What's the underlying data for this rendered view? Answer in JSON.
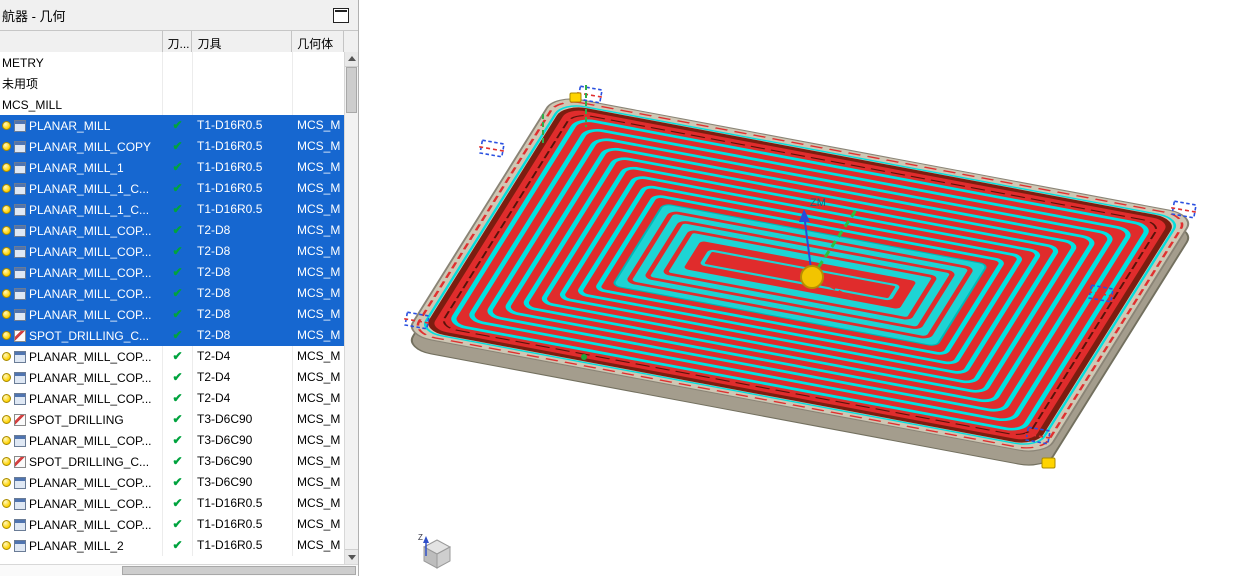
{
  "window": {
    "title": "航器 - 几何"
  },
  "table": {
    "columns": [
      "",
      "刀...",
      "刀具",
      "几何体"
    ],
    "rows": [
      {
        "name": "METRY",
        "kind": "group",
        "icon": "",
        "check": false,
        "tool": "",
        "geom": "",
        "selected": false
      },
      {
        "name": "未用项",
        "kind": "group",
        "icon": "",
        "check": false,
        "tool": "",
        "geom": "",
        "selected": false
      },
      {
        "name": "MCS_MILL",
        "kind": "group",
        "icon": "",
        "check": false,
        "tool": "",
        "geom": "",
        "selected": false
      },
      {
        "name": "PLANAR_MILL",
        "kind": "op",
        "icon": "mill",
        "check": true,
        "tool": "T1-D16R0.5",
        "geom": "MCS_M",
        "selected": true
      },
      {
        "name": "PLANAR_MILL_COPY",
        "kind": "op",
        "icon": "mill",
        "check": true,
        "tool": "T1-D16R0.5",
        "geom": "MCS_M",
        "selected": true
      },
      {
        "name": "PLANAR_MILL_1",
        "kind": "op",
        "icon": "mill",
        "check": true,
        "tool": "T1-D16R0.5",
        "geom": "MCS_M",
        "selected": true
      },
      {
        "name": "PLANAR_MILL_1_C...",
        "kind": "op",
        "icon": "mill",
        "check": true,
        "tool": "T1-D16R0.5",
        "geom": "MCS_M",
        "selected": true
      },
      {
        "name": "PLANAR_MILL_1_C...",
        "kind": "op",
        "icon": "mill",
        "check": true,
        "tool": "T1-D16R0.5",
        "geom": "MCS_M",
        "selected": true
      },
      {
        "name": "PLANAR_MILL_COP...",
        "kind": "op",
        "icon": "mill",
        "check": true,
        "tool": "T2-D8",
        "geom": "MCS_M",
        "selected": true
      },
      {
        "name": "PLANAR_MILL_COP...",
        "kind": "op",
        "icon": "mill",
        "check": true,
        "tool": "T2-D8",
        "geom": "MCS_M",
        "selected": true
      },
      {
        "name": "PLANAR_MILL_COP...",
        "kind": "op",
        "icon": "mill",
        "check": true,
        "tool": "T2-D8",
        "geom": "MCS_M",
        "selected": true
      },
      {
        "name": "PLANAR_MILL_COP...",
        "kind": "op",
        "icon": "mill",
        "check": true,
        "tool": "T2-D8",
        "geom": "MCS_M",
        "selected": true
      },
      {
        "name": "PLANAR_MILL_COP...",
        "kind": "op",
        "icon": "mill",
        "check": true,
        "tool": "T2-D8",
        "geom": "MCS_M",
        "selected": true
      },
      {
        "name": "SPOT_DRILLING_C...",
        "kind": "op",
        "icon": "drill",
        "check": true,
        "tool": "T2-D8",
        "geom": "MCS_M",
        "selected": true
      },
      {
        "name": "PLANAR_MILL_COP...",
        "kind": "op",
        "icon": "mill",
        "check": true,
        "tool": "T2-D4",
        "geom": "MCS_M",
        "selected": false
      },
      {
        "name": "PLANAR_MILL_COP...",
        "kind": "op",
        "icon": "mill",
        "check": true,
        "tool": "T2-D4",
        "geom": "MCS_M",
        "selected": false
      },
      {
        "name": "PLANAR_MILL_COP...",
        "kind": "op",
        "icon": "mill",
        "check": true,
        "tool": "T2-D4",
        "geom": "MCS_M",
        "selected": false
      },
      {
        "name": "SPOT_DRILLING",
        "kind": "op",
        "icon": "drill",
        "check": true,
        "tool": "T3-D6C90",
        "geom": "MCS_M",
        "selected": false
      },
      {
        "name": "PLANAR_MILL_COP...",
        "kind": "op",
        "icon": "mill",
        "check": true,
        "tool": "T3-D6C90",
        "geom": "MCS_M",
        "selected": false
      },
      {
        "name": "SPOT_DRILLING_C...",
        "kind": "op",
        "icon": "drill",
        "check": true,
        "tool": "T3-D6C90",
        "geom": "MCS_M",
        "selected": false
      },
      {
        "name": "PLANAR_MILL_COP...",
        "kind": "op",
        "icon": "mill",
        "check": true,
        "tool": "T3-D6C90",
        "geom": "MCS_M",
        "selected": false
      },
      {
        "name": "PLANAR_MILL_COP...",
        "kind": "op",
        "icon": "mill",
        "check": true,
        "tool": "T1-D16R0.5",
        "geom": "MCS_M",
        "selected": false
      },
      {
        "name": "PLANAR_MILL_COP...",
        "kind": "op",
        "icon": "mill",
        "check": true,
        "tool": "T1-D16R0.5",
        "geom": "MCS_M",
        "selected": false
      },
      {
        "name": "PLANAR_MILL_2",
        "kind": "op",
        "icon": "mill",
        "check": true,
        "tool": "T1-D16R0.5",
        "geom": "MCS_M",
        "selected": false
      }
    ]
  },
  "icons": {
    "check": "✔"
  },
  "viewport": {
    "zm_label": "ZM",
    "triad_z_label": "Z"
  },
  "colors": {
    "selection_blue": "#1667d0",
    "check_green": "#00a33e",
    "toolpath_red": "#e02c2c",
    "toolpath_cyan": "#00e2e2",
    "highlight_yellow": "#ffd400"
  }
}
